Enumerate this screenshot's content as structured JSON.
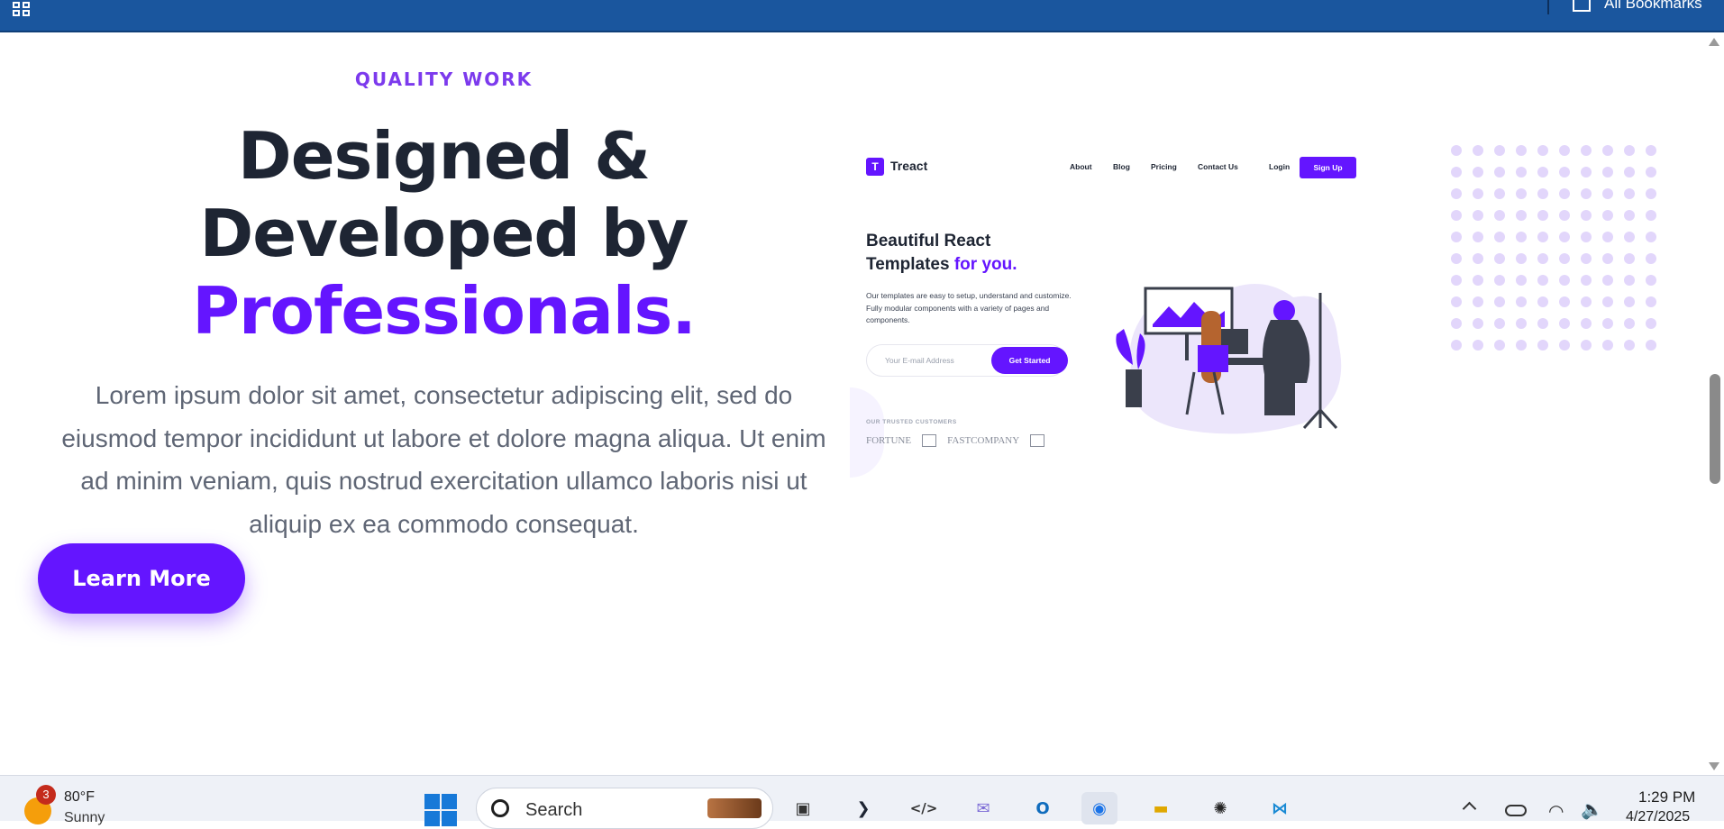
{
  "bookmarks_bar": {
    "all_bookmarks_label": "All Bookmarks"
  },
  "hero": {
    "eyebrow": "QUALITY WORK",
    "headline_line1": "Designed &",
    "headline_line2": "Developed by",
    "headline_accent": "Professionals.",
    "paragraph": "Lorem ipsum dolor sit amet, consectetur adipiscing elit, sed do eiusmod tempor incididunt ut labore et dolore magna aliqua. Ut enim ad minim veniam, quis nostrud exercitation ullamco laboris nisi ut aliquip ex ea commodo consequat.",
    "cta_label": "Learn More",
    "accent_color": "#6415ff",
    "heading_color": "#1e2533"
  },
  "preview": {
    "logo_mark": "T",
    "logo_text": "Treact",
    "nav": [
      "About",
      "Blog",
      "Pricing",
      "Contact Us"
    ],
    "login_label": "Login",
    "signup_label": "Sign Up",
    "title_line1": "Beautiful React",
    "title_line2": "Templates",
    "title_accent": "for you.",
    "description": "Our templates are easy to setup, understand and customize. Fully modular components with a variety of pages and components.",
    "email_placeholder": "Your E-mail Address",
    "get_started_label": "Get Started",
    "trusted_label": "OUR TRUSTED CUSTOMERS",
    "customer_logos": [
      "FORTUNE",
      "FASTCOMPANY"
    ]
  },
  "taskbar": {
    "weather_temp": "80°F",
    "weather_condition": "Sunny",
    "weather_badge": "3",
    "search_placeholder": "Search",
    "apps": [
      "file-explorer-icon",
      "terminal-icon",
      "dev-tools-icon",
      "mail-icon",
      "outlook-icon",
      "chrome-icon",
      "folder-icon",
      "chatgpt-icon",
      "vscode-icon"
    ],
    "time": "1:29 PM",
    "date": "4/27/2025"
  }
}
